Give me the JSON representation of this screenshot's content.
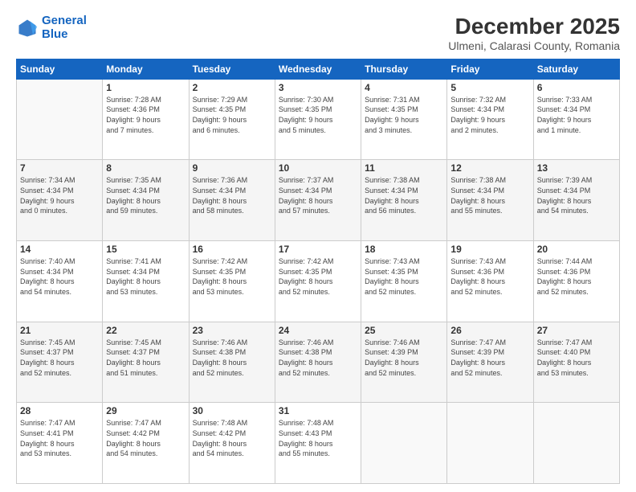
{
  "header": {
    "logo_line1": "General",
    "logo_line2": "Blue",
    "title": "December 2025",
    "subtitle": "Ulmeni, Calarasi County, Romania"
  },
  "calendar": {
    "days_of_week": [
      "Sunday",
      "Monday",
      "Tuesday",
      "Wednesday",
      "Thursday",
      "Friday",
      "Saturday"
    ],
    "weeks": [
      [
        {
          "day": "",
          "text": ""
        },
        {
          "day": "1",
          "text": "Sunrise: 7:28 AM\nSunset: 4:36 PM\nDaylight: 9 hours\nand 7 minutes."
        },
        {
          "day": "2",
          "text": "Sunrise: 7:29 AM\nSunset: 4:35 PM\nDaylight: 9 hours\nand 6 minutes."
        },
        {
          "day": "3",
          "text": "Sunrise: 7:30 AM\nSunset: 4:35 PM\nDaylight: 9 hours\nand 5 minutes."
        },
        {
          "day": "4",
          "text": "Sunrise: 7:31 AM\nSunset: 4:35 PM\nDaylight: 9 hours\nand 3 minutes."
        },
        {
          "day": "5",
          "text": "Sunrise: 7:32 AM\nSunset: 4:34 PM\nDaylight: 9 hours\nand 2 minutes."
        },
        {
          "day": "6",
          "text": "Sunrise: 7:33 AM\nSunset: 4:34 PM\nDaylight: 9 hours\nand 1 minute."
        }
      ],
      [
        {
          "day": "7",
          "text": "Sunrise: 7:34 AM\nSunset: 4:34 PM\nDaylight: 9 hours\nand 0 minutes."
        },
        {
          "day": "8",
          "text": "Sunrise: 7:35 AM\nSunset: 4:34 PM\nDaylight: 8 hours\nand 59 minutes."
        },
        {
          "day": "9",
          "text": "Sunrise: 7:36 AM\nSunset: 4:34 PM\nDaylight: 8 hours\nand 58 minutes."
        },
        {
          "day": "10",
          "text": "Sunrise: 7:37 AM\nSunset: 4:34 PM\nDaylight: 8 hours\nand 57 minutes."
        },
        {
          "day": "11",
          "text": "Sunrise: 7:38 AM\nSunset: 4:34 PM\nDaylight: 8 hours\nand 56 minutes."
        },
        {
          "day": "12",
          "text": "Sunrise: 7:38 AM\nSunset: 4:34 PM\nDaylight: 8 hours\nand 55 minutes."
        },
        {
          "day": "13",
          "text": "Sunrise: 7:39 AM\nSunset: 4:34 PM\nDaylight: 8 hours\nand 54 minutes."
        }
      ],
      [
        {
          "day": "14",
          "text": "Sunrise: 7:40 AM\nSunset: 4:34 PM\nDaylight: 8 hours\nand 54 minutes."
        },
        {
          "day": "15",
          "text": "Sunrise: 7:41 AM\nSunset: 4:34 PM\nDaylight: 8 hours\nand 53 minutes."
        },
        {
          "day": "16",
          "text": "Sunrise: 7:42 AM\nSunset: 4:35 PM\nDaylight: 8 hours\nand 53 minutes."
        },
        {
          "day": "17",
          "text": "Sunrise: 7:42 AM\nSunset: 4:35 PM\nDaylight: 8 hours\nand 52 minutes."
        },
        {
          "day": "18",
          "text": "Sunrise: 7:43 AM\nSunset: 4:35 PM\nDaylight: 8 hours\nand 52 minutes."
        },
        {
          "day": "19",
          "text": "Sunrise: 7:43 AM\nSunset: 4:36 PM\nDaylight: 8 hours\nand 52 minutes."
        },
        {
          "day": "20",
          "text": "Sunrise: 7:44 AM\nSunset: 4:36 PM\nDaylight: 8 hours\nand 52 minutes."
        }
      ],
      [
        {
          "day": "21",
          "text": "Sunrise: 7:45 AM\nSunset: 4:37 PM\nDaylight: 8 hours\nand 52 minutes."
        },
        {
          "day": "22",
          "text": "Sunrise: 7:45 AM\nSunset: 4:37 PM\nDaylight: 8 hours\nand 51 minutes."
        },
        {
          "day": "23",
          "text": "Sunrise: 7:46 AM\nSunset: 4:38 PM\nDaylight: 8 hours\nand 52 minutes."
        },
        {
          "day": "24",
          "text": "Sunrise: 7:46 AM\nSunset: 4:38 PM\nDaylight: 8 hours\nand 52 minutes."
        },
        {
          "day": "25",
          "text": "Sunrise: 7:46 AM\nSunset: 4:39 PM\nDaylight: 8 hours\nand 52 minutes."
        },
        {
          "day": "26",
          "text": "Sunrise: 7:47 AM\nSunset: 4:39 PM\nDaylight: 8 hours\nand 52 minutes."
        },
        {
          "day": "27",
          "text": "Sunrise: 7:47 AM\nSunset: 4:40 PM\nDaylight: 8 hours\nand 53 minutes."
        }
      ],
      [
        {
          "day": "28",
          "text": "Sunrise: 7:47 AM\nSunset: 4:41 PM\nDaylight: 8 hours\nand 53 minutes."
        },
        {
          "day": "29",
          "text": "Sunrise: 7:47 AM\nSunset: 4:42 PM\nDaylight: 8 hours\nand 54 minutes."
        },
        {
          "day": "30",
          "text": "Sunrise: 7:48 AM\nSunset: 4:42 PM\nDaylight: 8 hours\nand 54 minutes."
        },
        {
          "day": "31",
          "text": "Sunrise: 7:48 AM\nSunset: 4:43 PM\nDaylight: 8 hours\nand 55 minutes."
        },
        {
          "day": "",
          "text": ""
        },
        {
          "day": "",
          "text": ""
        },
        {
          "day": "",
          "text": ""
        }
      ]
    ]
  }
}
